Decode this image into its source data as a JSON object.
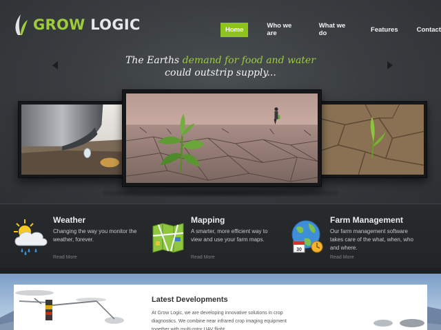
{
  "brand": {
    "name_part1": "GROW",
    "name_part2": " LOGIC",
    "accent": "#8dc21f"
  },
  "nav": {
    "items": [
      {
        "label": "Home",
        "active": true
      },
      {
        "label": "Who we are",
        "active": false
      },
      {
        "label": "What we do",
        "active": false
      },
      {
        "label": "Features",
        "active": false
      },
      {
        "label": "Contact",
        "active": false
      }
    ]
  },
  "hero": {
    "tagline_pre": "The Earths ",
    "tagline_highlight": "demand for food and water",
    "tagline_line2": "could outstrip supply...",
    "prev_icon": "arrow-left-icon",
    "next_icon": "arrow-right-icon"
  },
  "features": [
    {
      "title": "Weather",
      "description": "Changing the way you monitor the weather, forever.",
      "link": "Read More",
      "icon": "weather-icon"
    },
    {
      "title": "Mapping",
      "description": "A smarter, more efficient way to view and use your farm maps.",
      "link": "Read More",
      "icon": "map-icon"
    },
    {
      "title": "Farm Management",
      "description": "Our farm management software takes care of the what, when, who and where.",
      "link": "Read More",
      "icon": "globe-calendar-icon"
    }
  ],
  "latest": {
    "title": "Latest Developments",
    "text": "At Grow Logic, we are developing innovative solutions in crop diagnostics. We combine near infrared crop imaging equipment together with multi-rotor UAV flight"
  }
}
